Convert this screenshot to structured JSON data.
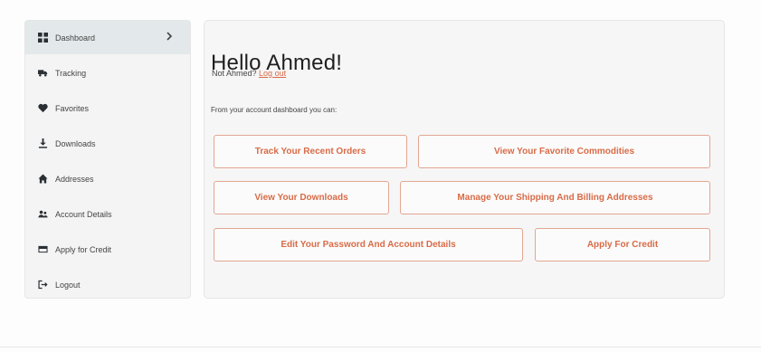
{
  "sidebar": {
    "items": [
      {
        "label": "Dashboard",
        "icon": "dashboard-grid-icon"
      },
      {
        "label": "Tracking",
        "icon": "truck-icon"
      },
      {
        "label": "Favorites",
        "icon": "heart-icon"
      },
      {
        "label": "Downloads",
        "icon": "download-icon"
      },
      {
        "label": "Addresses",
        "icon": "home-icon"
      },
      {
        "label": "Account Details",
        "icon": "users-icon"
      },
      {
        "label": "Apply for Credit",
        "icon": "credit-card-icon"
      },
      {
        "label": "Logout",
        "icon": "logout-icon"
      }
    ],
    "active_index": 0
  },
  "main": {
    "greeting": "Hello Ahmed!",
    "not_user_text": "Not Ahmed?",
    "logout_link": "Log out",
    "intro": "From your account dashboard you can:",
    "actions": [
      "Track Your Recent Orders",
      "View Your Favorite Commodities",
      "View Your Downloads",
      "Manage Your Shipping And Billing Addresses",
      "Edit Your Password And Account Details",
      "Apply For Credit"
    ]
  },
  "colors": {
    "accent": "#d96b47",
    "accent_border": "#e3a592",
    "active_bg": "#e3e8ea",
    "card_bg": "#f6f6f6"
  }
}
